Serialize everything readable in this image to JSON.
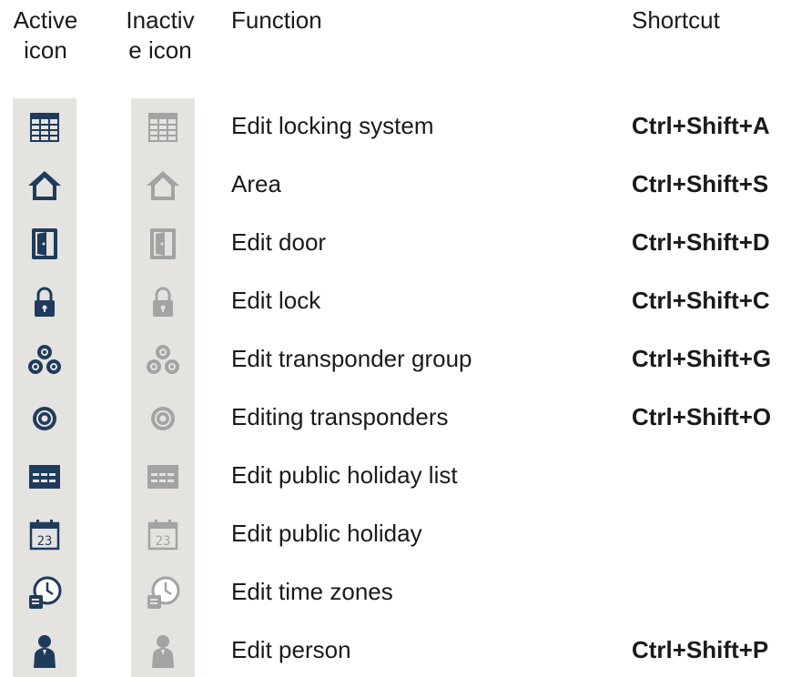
{
  "headers": {
    "active": "Active icon",
    "inactive": "Inactive icon",
    "function": "Function",
    "shortcut": "Shortcut"
  },
  "colors": {
    "active_icon": "#1f3b5c",
    "inactive_icon": "#a3a3a3",
    "icon_strip_bg": "#e4e3e0"
  },
  "rows": [
    {
      "icon": "grid-table-icon",
      "function": "Edit locking system",
      "shortcut": "Ctrl+Shift+A"
    },
    {
      "icon": "house-icon",
      "function": "Area",
      "shortcut": "Ctrl+Shift+S"
    },
    {
      "icon": "door-icon",
      "function": "Edit door",
      "shortcut": "Ctrl+Shift+D"
    },
    {
      "icon": "padlock-icon",
      "function": "Edit lock",
      "shortcut": "Ctrl+Shift+C"
    },
    {
      "icon": "transponder-group-icon",
      "function": "Edit transponder group",
      "shortcut": "Ctrl+Shift+G"
    },
    {
      "icon": "transponder-icon",
      "function": "Editing transponders",
      "shortcut": "Ctrl+Shift+O"
    },
    {
      "icon": "holiday-list-icon",
      "function": "Edit public holiday list",
      "shortcut": ""
    },
    {
      "icon": "calendar-icon",
      "function": "Edit public holiday",
      "shortcut": ""
    },
    {
      "icon": "clock-icon",
      "function": "Edit time zones",
      "shortcut": ""
    },
    {
      "icon": "person-icon",
      "function": "Edit person",
      "shortcut": "Ctrl+Shift+P"
    }
  ],
  "calendar_day": "23"
}
